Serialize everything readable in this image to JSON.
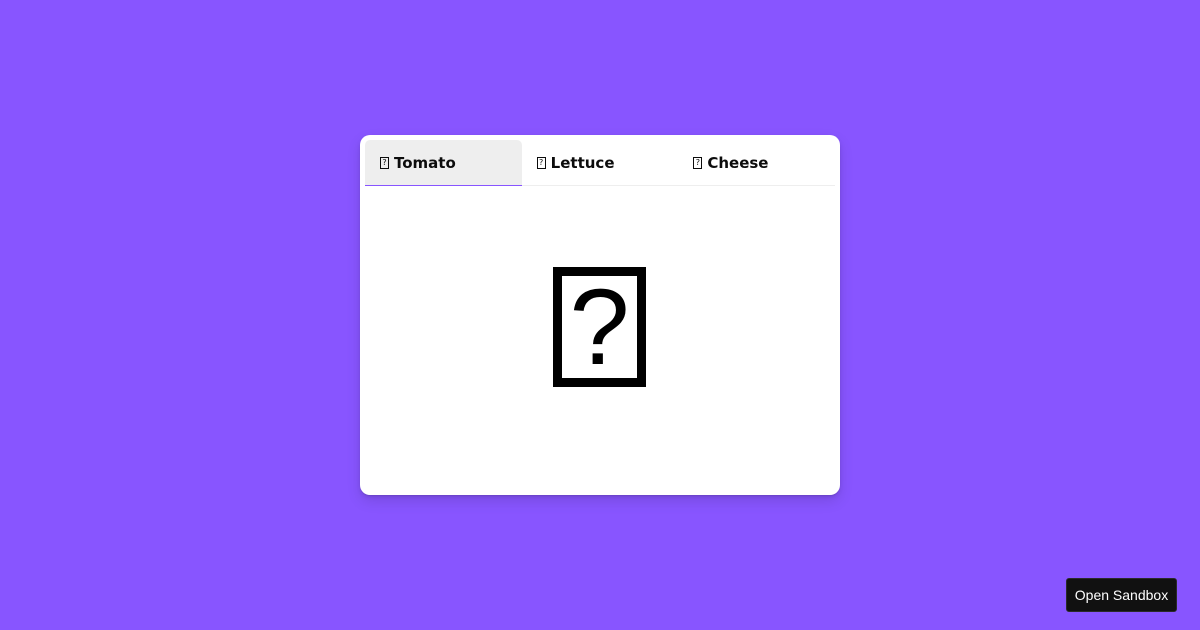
{
  "tabs": [
    {
      "icon": "missing-glyph-icon",
      "label": "Tomato",
      "selected": true
    },
    {
      "icon": "missing-glyph-icon",
      "label": "Lettuce",
      "selected": false
    },
    {
      "icon": "missing-glyph-icon",
      "label": "Cheese",
      "selected": false
    }
  ],
  "content": {
    "icon": "missing-glyph-icon"
  },
  "sandbox_button": {
    "label": "Open Sandbox"
  },
  "colors": {
    "background": "#8855ff",
    "window": "#ffffff",
    "selected_tab": "#eeeeee",
    "accent": "#8855ff",
    "button": "#111111"
  }
}
